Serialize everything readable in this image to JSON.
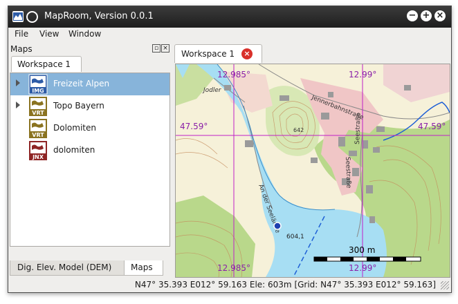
{
  "window": {
    "title": "MapRoom, Version 0.0.1",
    "buttons": [
      "minimize",
      "maximize",
      "close"
    ]
  },
  "menu": {
    "file": "File",
    "view": "View",
    "window": "Window"
  },
  "left_panel": {
    "title": "Maps",
    "tab": "Workspace 1",
    "items": [
      {
        "label": "Freizeit Alpen",
        "badge": "IMG",
        "color": "#2d5ba6",
        "selected": true,
        "expandable": true
      },
      {
        "label": "Topo Bayern",
        "badge": "VRT",
        "color": "#8a7320",
        "selected": false,
        "expandable": true
      },
      {
        "label": "Dolomiten",
        "badge": "VRT",
        "color": "#8a7320",
        "selected": false,
        "expandable": false
      },
      {
        "label": "dolomiten",
        "badge": "JNX",
        "color": "#8e2525",
        "selected": false,
        "expandable": false
      }
    ],
    "bottom_tabs": [
      "Dig. Elev. Model (DEM)",
      "Maps"
    ]
  },
  "map_view": {
    "tab": "Workspace 1",
    "grid_labels": {
      "lon_left_top": "12.985°",
      "lon_right_top": "12.99°",
      "lat_left": "47.59°",
      "lat_right": "47.59°",
      "lon_left_bottom": "12.985°",
      "lon_right_bottom": "12.99°"
    },
    "scale": "300 m",
    "map_text": {
      "jodler": "Jodler",
      "jenner": "Jennerbahnstraße",
      "seestr1": "Seestraße",
      "seestr2": "Seestraße",
      "andersee": "An der Seelände",
      "elev642": "642",
      "elev604": "604,1"
    }
  },
  "status": "N47° 35.393 E012° 59.163  Ele: 603m  [Grid: N47° 35.393 E012° 59.163]"
}
